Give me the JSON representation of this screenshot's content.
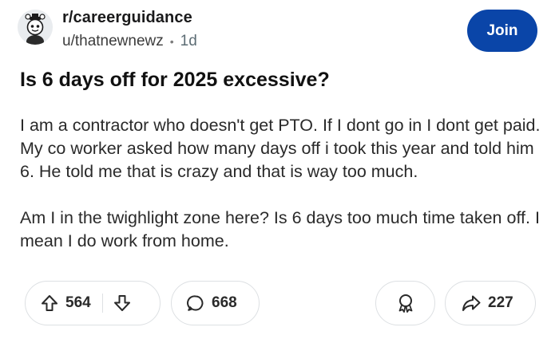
{
  "post": {
    "subreddit": "r/careerguidance",
    "author": "u/thatnewnewz",
    "separator": "•",
    "age": "1d",
    "join_label": "Join",
    "title": "Is 6 days off for 2025 excessive?",
    "paragraphs": [
      "I am a contractor who doesn't get PTO. If I dont go in I dont get paid. My co worker asked how many days off i took this year and told him 6. He told me that is crazy and that is way too much.",
      "Am I in the twighlight zone here? Is 6 days too much time taken off. I mean I do work from home."
    ]
  },
  "actions": {
    "upvotes": "564",
    "comments": "668",
    "shares": "227"
  },
  "icons": {
    "upvote": "arrow-up-icon",
    "downvote": "arrow-down-icon",
    "comment": "speech-bubble-icon",
    "award": "award-ribbon-icon",
    "share": "share-arrow-icon"
  },
  "colors": {
    "join_button": "#0a45a8",
    "text": "#1a1a1b",
    "border": "#dde0e3"
  }
}
